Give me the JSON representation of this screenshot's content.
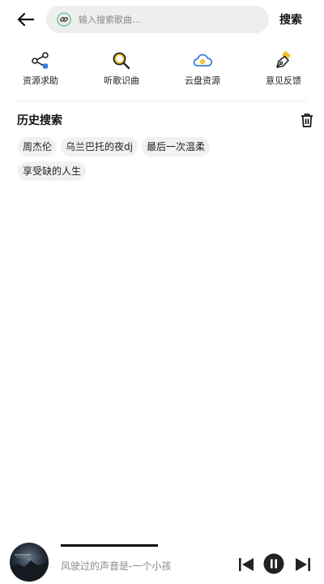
{
  "header": {
    "back_icon": "arrow-left-icon",
    "search_icon": "link-icon",
    "search_placeholder": "输入搜索歌曲...",
    "search_value": "",
    "search_button": "搜索"
  },
  "quick_actions": [
    {
      "label": "资源求助",
      "icon": "share-nodes-icon"
    },
    {
      "label": "听歌识曲",
      "icon": "magnifier-icon"
    },
    {
      "label": "云盘资源",
      "icon": "cloud-icon"
    },
    {
      "label": "意见反馈",
      "icon": "pen-feedback-icon"
    }
  ],
  "history": {
    "title": "历史搜索",
    "clear_icon": "trash-icon",
    "items": [
      "周杰伦",
      "乌兰巴托的夜dj",
      "最后一次温柔",
      "享受缺的人生"
    ]
  },
  "player": {
    "track_text": "风驶过的声音是-一个小孩",
    "progress": 0.3,
    "controls": [
      "skip-previous-icon",
      "pause-icon",
      "skip-next-icon"
    ]
  },
  "colors": {
    "accent_blue": "#3b7de0",
    "accent_yellow": "#f2c230",
    "search_bg": "#eeeeee",
    "chip_bg": "#f1f1f1"
  }
}
